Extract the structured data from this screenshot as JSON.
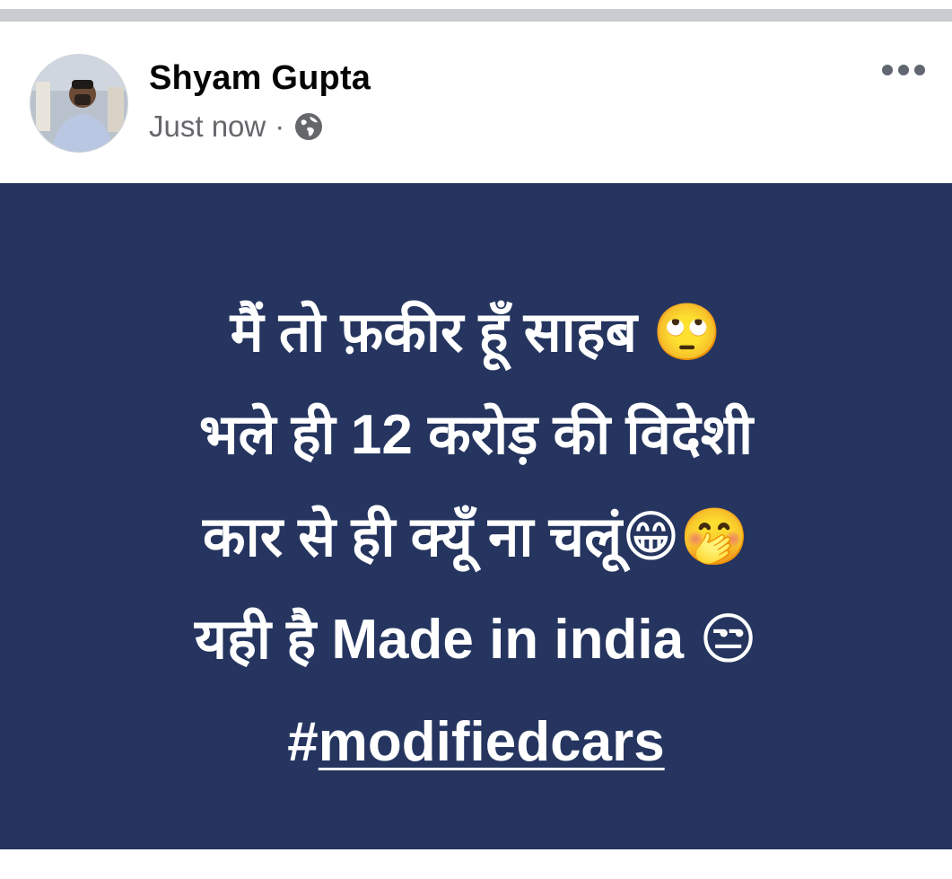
{
  "post": {
    "author_name": "Shyam Gupta",
    "timestamp": "Just now",
    "separator": "·",
    "privacy_icon": "globe-icon",
    "more_icon": "more-options-icon",
    "text_card": {
      "background_color": "#25355f",
      "lines": [
        "मैं तो फ़कीर हूँ साहब 🙄",
        "भले ही 12 करोड़ की विदेशी",
        "कार से ही क्यूँ ना चलूं😁🤭",
        "यही है Made in india 😒"
      ],
      "hashtag_prefix": "#",
      "hashtag_link": "modifiedcars"
    }
  }
}
